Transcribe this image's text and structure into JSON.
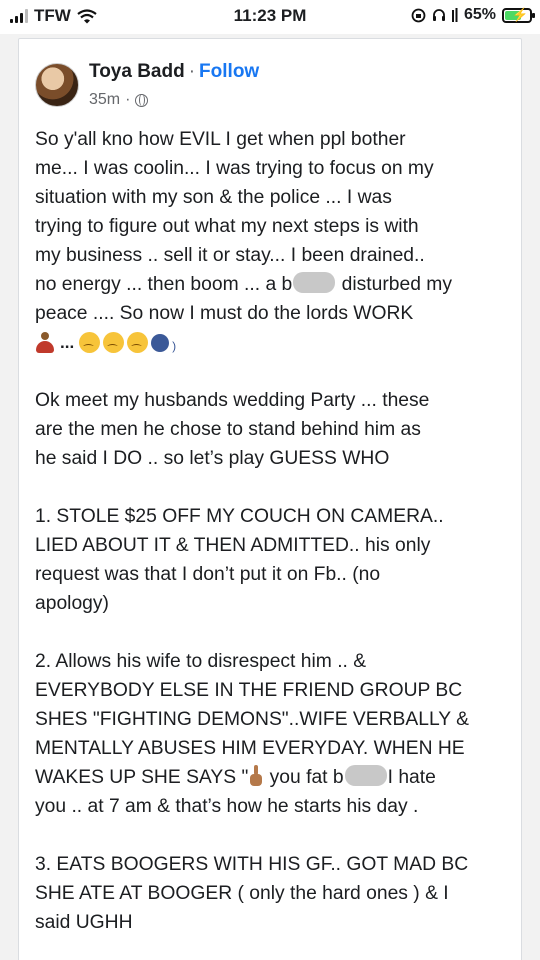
{
  "status_bar": {
    "carrier": "TFW",
    "time": "11:23 PM",
    "battery_label": "65%",
    "battery_level": 0.65
  },
  "post": {
    "author": "Toya Badd",
    "separator": "·",
    "follow_label": "Follow",
    "time_ago": "35m",
    "privacy_icon": "globe-icon",
    "p1_line1": "So y'all kno how EVIL I get when ppl bother",
    "p1_line2": "me... I was coolin... I was trying to focus on my",
    "p1_line3": "situation with my son & the police ... I was",
    "p1_line4": "trying to figure out what my next steps is with",
    "p1_line5": "my business .. sell it or stay... I been drained..",
    "p1_line6a": "no energy ... then boom ... a b",
    "p1_line6b": "disturbed my",
    "p1_line7": "peace .... So now I must do the lords WORK",
    "p1_emoji_ellipsis": "...",
    "p2": "Ok meet my husbands wedding Party ... these\nare the men he chose to stand behind him as\nhe said I DO .. so let’s play GUESS WHO",
    "p3": "1. STOLE $25 OFF MY COUCH ON CAMERA..\nLIED ABOUT IT & THEN ADMITTED.. his only\nrequest was that I don’t put it on Fb.. (no\napology)",
    "p4_lines": "2. Allows his wife to disrespect him .. &\nEVERYBODY ELSE IN THE FRIEND GROUP BC\nSHES \"FIGHTING DEMONS\"..WIFE VERBALLY &\nMENTALLY ABUSES HIM EVERYDAY. WHEN HE",
    "p4_line5a": "WAKES UP SHE SAYS \"",
    "p4_line5b": "you fat b",
    "p4_line5c": "I hate",
    "p4_line6": "you .. at 7 am & that’s how he starts his day .",
    "p5": "3. EATS BOOGERS WITH HIS GF.. GOT MAD BC\nSHE ATE AT BOOGER ( only the hard ones ) & I\nsaid UGHH"
  },
  "colors": {
    "link_blue": "#1877f2",
    "meta_gray": "#65676b",
    "text": "#1c1e21"
  }
}
